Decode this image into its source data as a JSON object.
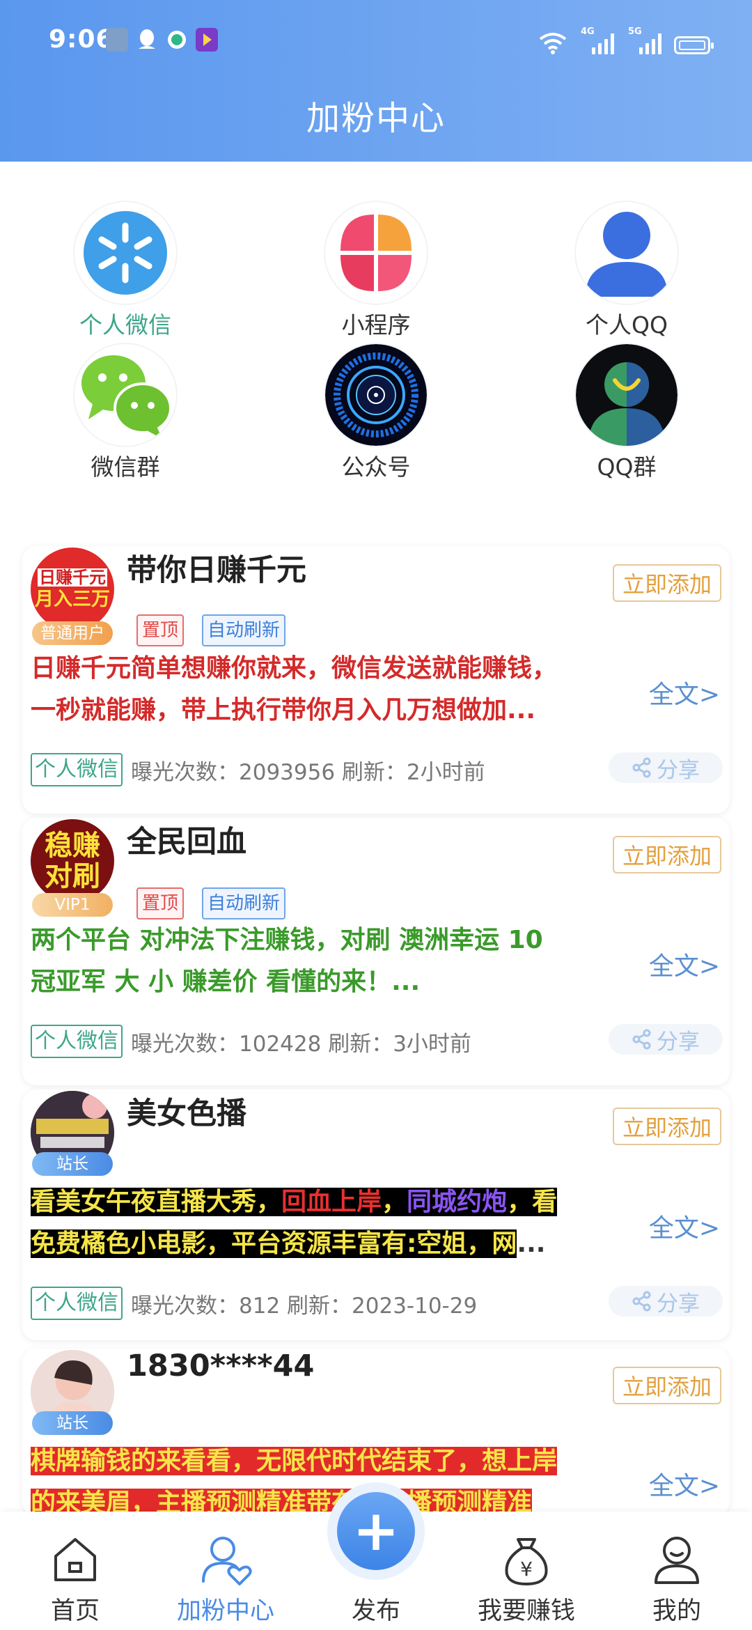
{
  "status_bar": {
    "time": "9:06",
    "signal1": "4G",
    "signal2": "5G"
  },
  "header": {
    "title": "加粉中心"
  },
  "categories": [
    {
      "label": "个人微信"
    },
    {
      "label": "小程序"
    },
    {
      "label": "个人QQ"
    },
    {
      "label": "微信群"
    },
    {
      "label": "公众号"
    },
    {
      "label": "QQ群"
    }
  ],
  "listings": [
    {
      "avatar_text_line1": "日赚千元",
      "avatar_text_line2": "月入三万",
      "role": "普通用户",
      "title": "带你日赚千元",
      "add_label": "立即添加",
      "tag_top": "置顶",
      "tag_refresh": "自动刷新",
      "desc_line1": "日赚千元简单想赚你就来，微信发送就能赚钱，",
      "desc_line2": "一秒就能赚，带上执行带你月入几万想做加...",
      "fulltext": "全文>",
      "type": "个人微信",
      "meta": "曝光次数：2093956  刷新：2小时前",
      "share": "分享",
      "desc_color": "#d42a2a"
    },
    {
      "avatar_text_line1": "稳赚",
      "avatar_text_line2": "对刷",
      "role": "VIP1",
      "title": "全民回血",
      "add_label": "立即添加",
      "tag_top": "置顶",
      "tag_refresh": "自动刷新",
      "desc_line1": "两个平台 对冲法下注赚钱，对刷 澳洲幸运 10",
      "desc_line2": "冠亚军 大 小 赚差价 看懂的来！...",
      "fulltext": "全文>",
      "type": "个人微信",
      "meta": "曝光次数：102428  刷新：3小时前",
      "share": "分享",
      "desc_color": "#3a9a2a"
    },
    {
      "role": "站长",
      "title": "美女色播",
      "add_label": "立即添加",
      "desc_a": "看美女午夜直播大秀，",
      "desc_b": "回血上岸",
      "desc_c": "，",
      "desc_d": "同城约炮",
      "desc_e": "，看",
      "desc_line2": "免费橘色小电影，平台资源丰富有:空姐，网",
      "desc_ellipsis": "...",
      "fulltext": "全文>",
      "type": "个人微信",
      "meta": "曝光次数：812  刷新：2023-10-29",
      "share": "分享"
    },
    {
      "role": "站长",
      "title": "1830****44",
      "add_label": "立即添加",
      "desc_line1": "棋牌输钱的来看看，无限代时代结束了，想上岸",
      "desc_line2": "的来美眉，主播预测精准带有，主播预测精准",
      "fulltext": "全文>"
    }
  ],
  "bottom_nav": [
    {
      "label": "首页"
    },
    {
      "label": "加粉中心"
    },
    {
      "label": "发布"
    },
    {
      "label": "我要赚钱"
    },
    {
      "label": "我的"
    }
  ],
  "colors": {
    "accent": "#4a8be4",
    "wechat_green": "#3ca68a",
    "add_orange": "#e3a03d"
  }
}
